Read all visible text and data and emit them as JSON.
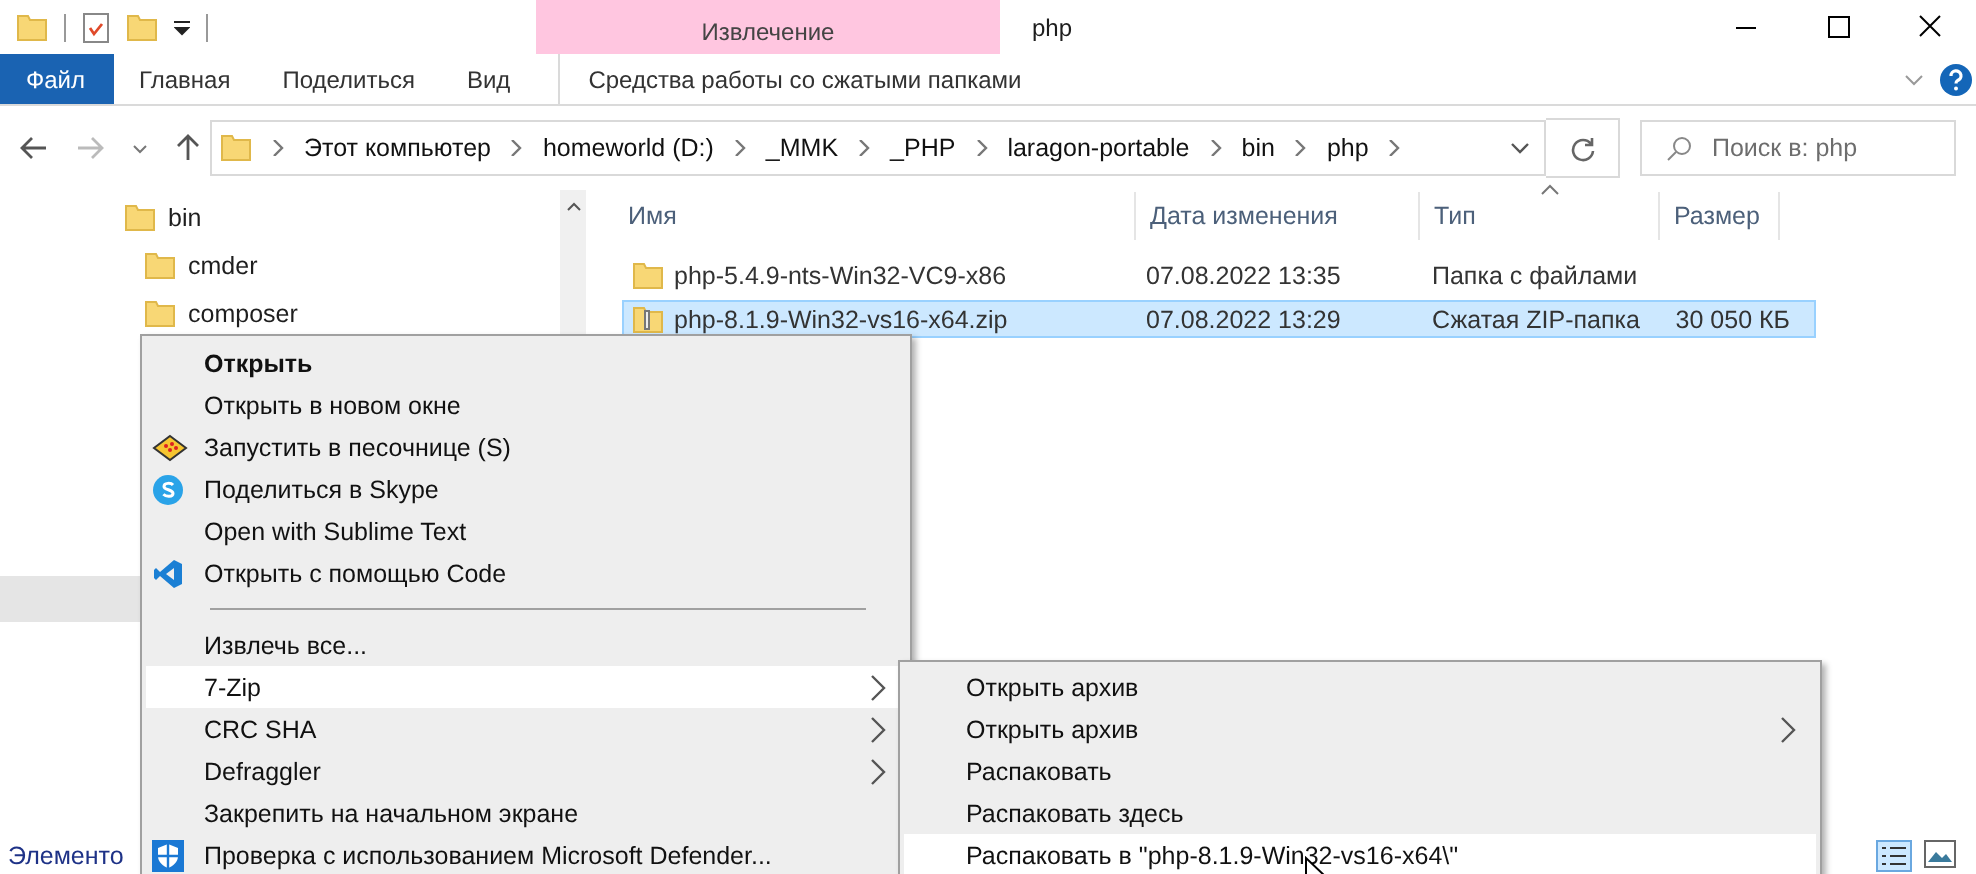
{
  "window": {
    "title": "php",
    "context_tab": "Извлечение"
  },
  "ribbon_tabs": [
    {
      "label": "Файл",
      "kind": "file"
    },
    {
      "label": "Главная",
      "kind": "normal"
    },
    {
      "label": "Поделиться",
      "kind": "normal"
    },
    {
      "label": "Вид",
      "kind": "normal"
    },
    {
      "label": "Средства работы со сжатыми папками",
      "kind": "context"
    }
  ],
  "address": {
    "path": [
      "Этот компьютер",
      "homeworld (D:)",
      "_MMK",
      "_PHP",
      "laragon-portable",
      "bin",
      "php"
    ]
  },
  "search": {
    "placeholder": "Поиск в: php"
  },
  "sidebar": {
    "items": [
      {
        "label": "bin",
        "children": [
          {
            "label": "cmder"
          },
          {
            "label": "composer"
          }
        ]
      }
    ]
  },
  "table": {
    "columns": [
      {
        "label": "Имя",
        "sorted": false
      },
      {
        "label": "Дата изменения",
        "sorted": false
      },
      {
        "label": "Тип",
        "sorted": true
      },
      {
        "label": "Размер",
        "sorted": false
      }
    ],
    "rows": [
      {
        "kind": "folder",
        "name": "php-5.4.9-nts-Win32-VC9-x86",
        "date": "07.08.2022 13:35",
        "type": "Папка с файлами",
        "size": "",
        "selected": false
      },
      {
        "kind": "zip",
        "name": "php-8.1.9-Win32-vs16-x64.zip",
        "date": "07.08.2022 13:29",
        "type": "Сжатая ZIP-папка",
        "size": "30 050 КБ",
        "selected": true
      }
    ]
  },
  "status_bar": {
    "text": "Элементо"
  },
  "context_menu": {
    "groups": [
      [
        {
          "label": "Открыть",
          "kind": "plain",
          "bold": true,
          "submenu": false,
          "selected": false
        },
        {
          "label": "Открыть в новом окне",
          "kind": "plain",
          "bold": false,
          "submenu": false,
          "selected": false
        },
        {
          "label": "Запустить в песочнице (S)",
          "kind": "sandbox",
          "bold": false,
          "submenu": false,
          "selected": false
        },
        {
          "label": "Поделиться в Skype",
          "kind": "skype",
          "bold": false,
          "submenu": false,
          "selected": false
        },
        {
          "label": "Open with Sublime Text",
          "kind": "plain",
          "bold": false,
          "submenu": false,
          "selected": false
        },
        {
          "label": "Открыть с помощью Code",
          "kind": "vscode",
          "bold": false,
          "submenu": false,
          "selected": false
        }
      ],
      [
        {
          "label": "Извлечь все...",
          "kind": "plain",
          "bold": false,
          "submenu": false,
          "selected": false
        },
        {
          "label": "7-Zip",
          "kind": "plain",
          "bold": false,
          "submenu": true,
          "selected": true
        },
        {
          "label": "CRC SHA",
          "kind": "plain",
          "bold": false,
          "submenu": true,
          "selected": false
        },
        {
          "label": "Defraggler",
          "kind": "plain",
          "bold": false,
          "submenu": true,
          "selected": false
        },
        {
          "label": "Закрепить на начальном экране",
          "kind": "plain",
          "bold": false,
          "submenu": false,
          "selected": false
        },
        {
          "label": "Проверка с использованием Microsoft Defender...",
          "kind": "defender",
          "bold": false,
          "submenu": false,
          "selected": false
        }
      ]
    ]
  },
  "submenu": {
    "items": [
      {
        "label": "Открыть архив",
        "submenu": false,
        "selected": false
      },
      {
        "label": "Открыть архив",
        "submenu": true,
        "selected": false
      },
      {
        "label": "Распаковать",
        "submenu": false,
        "selected": false
      },
      {
        "label": "Распаковать здесь",
        "submenu": false,
        "selected": false
      },
      {
        "label": "Распаковать в \"php-8.1.9-Win32-vs16-x64\\\"",
        "submenu": false,
        "selected": true
      }
    ]
  }
}
